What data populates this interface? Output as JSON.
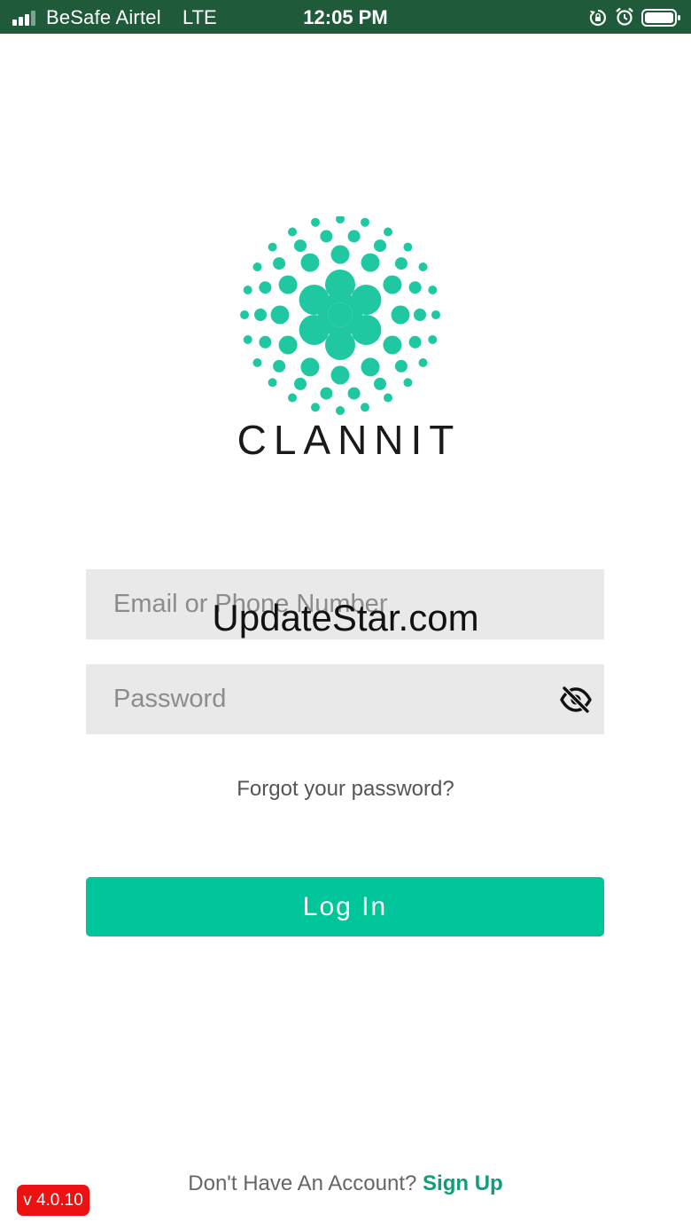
{
  "status_bar": {
    "carrier": "BeSafe Airtel",
    "network": "LTE",
    "time": "12:05 PM",
    "icons": [
      "signal-icon",
      "rotation-lock-icon",
      "alarm-icon",
      "battery-icon"
    ],
    "background": "#1f5a3a"
  },
  "logo": {
    "wordmark": "CLANNIT",
    "accent_color": "#1fc8a0"
  },
  "form": {
    "email_placeholder": "Email or Phone Number",
    "password_placeholder": "Password",
    "email_value": "",
    "password_value": "",
    "password_toggle_icon": "eye-slash-icon",
    "forgot_label": "Forgot your password?",
    "login_label": "Log In",
    "login_color": "#00c49a"
  },
  "watermark": "UpdateStar.com",
  "footer": {
    "signup_prompt": "Don't Have An Account?",
    "signup_link": "Sign Up",
    "version": "v 4.0.10",
    "version_color": "#ee1111"
  }
}
